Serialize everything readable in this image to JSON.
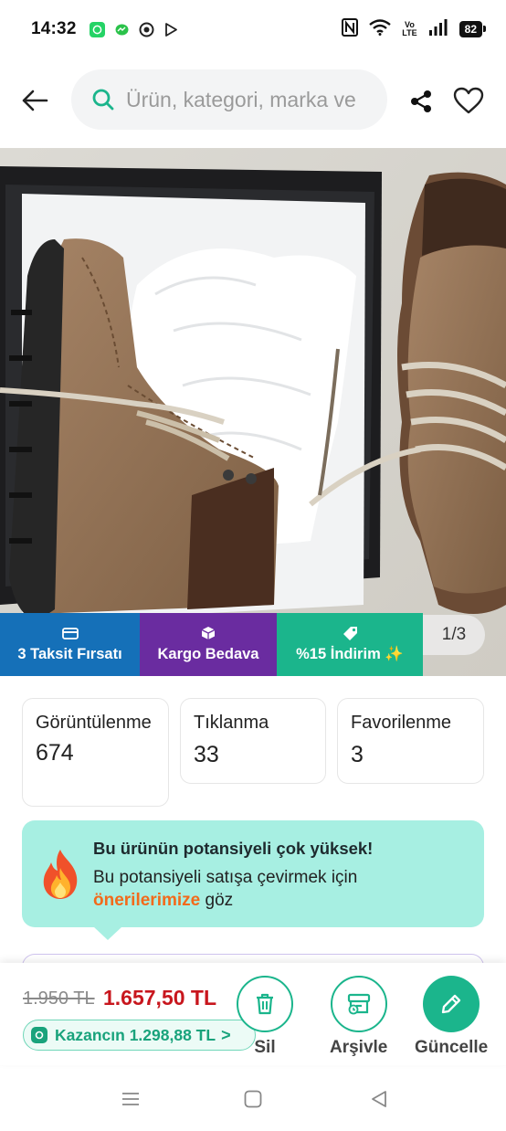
{
  "status_bar": {
    "time": "14:32",
    "battery": "82",
    "volte_top": "Vo",
    "volte_bottom": "LTE",
    "icons": [
      "whatsapp-icon",
      "messenger-icon",
      "chrome-icon",
      "play-store-icon",
      "nfc-icon",
      "wifi-icon",
      "signal-icon",
      "battery-icon"
    ]
  },
  "header": {
    "search_placeholder": "Ürün, kategori, marka ve",
    "icons": [
      "back-arrow-icon",
      "search-icon",
      "share-icon",
      "heart-icon"
    ]
  },
  "gallery": {
    "page_indicator": "1/3",
    "image_description_icon": "product-photo"
  },
  "badges": [
    {
      "label": "3 Taksit Fırsatı",
      "icon": "card-icon",
      "color": "#1570b8"
    },
    {
      "label": "Kargo Bedava",
      "icon": "box-icon",
      "color": "#6a2ca0"
    },
    {
      "label": "%15 İndirim ✨",
      "icon": "tag-icon",
      "color": "#1bb58c"
    }
  ],
  "stats": [
    {
      "label": "Görüntülenme",
      "value": "674"
    },
    {
      "label": "Tıklanma",
      "value": "33"
    },
    {
      "label": "Favorilenme",
      "value": "3"
    }
  ],
  "potential": {
    "title": "Bu ürünün potansiyeli çok yüksek!",
    "text_before": "Bu potansiyeli satışa çevirmek için ",
    "link": "önerilerimize",
    "text_after": " göz",
    "icon": "fire-icon"
  },
  "bottom_bar": {
    "old_price": "1.950 TL",
    "new_price": "1.657,50 TL",
    "earn_text": "Kazancın 1.298,88 TL",
    "earn_chevron": ">",
    "actions": [
      {
        "label": "Sil",
        "icon": "trash-icon"
      },
      {
        "label": "Arşivle",
        "icon": "archive-icon"
      },
      {
        "label": "Güncelle",
        "icon": "pencil-icon"
      }
    ]
  },
  "colors": {
    "accent_green": "#1bb58c",
    "price_red": "#c8161d",
    "potential_bg": "#a7efe2",
    "link_orange": "#f26a1b"
  }
}
